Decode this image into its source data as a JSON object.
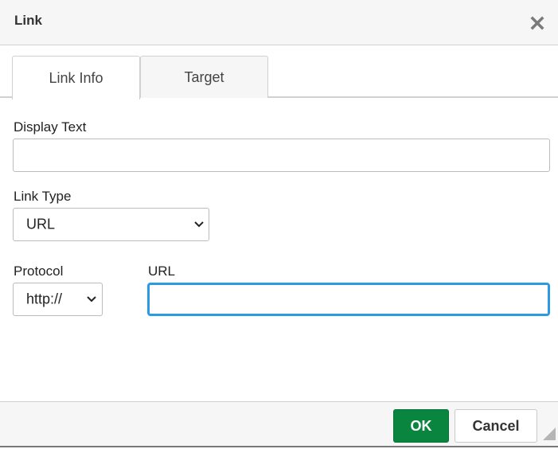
{
  "dialog": {
    "title": "Link",
    "close_icon": "close-icon"
  },
  "tabs": [
    {
      "label": "Link Info",
      "active": true
    },
    {
      "label": "Target",
      "active": false
    }
  ],
  "form": {
    "display_text": {
      "label": "Display Text",
      "value": ""
    },
    "link_type": {
      "label": "Link Type",
      "selected": "URL"
    },
    "protocol": {
      "label": "Protocol",
      "selected": "http://"
    },
    "url": {
      "label": "URL",
      "value": "",
      "focused": true
    }
  },
  "footer": {
    "ok_label": "OK",
    "cancel_label": "Cancel"
  },
  "colors": {
    "ok_button": "#0a8540",
    "focus_border": "#2b9ae3"
  }
}
